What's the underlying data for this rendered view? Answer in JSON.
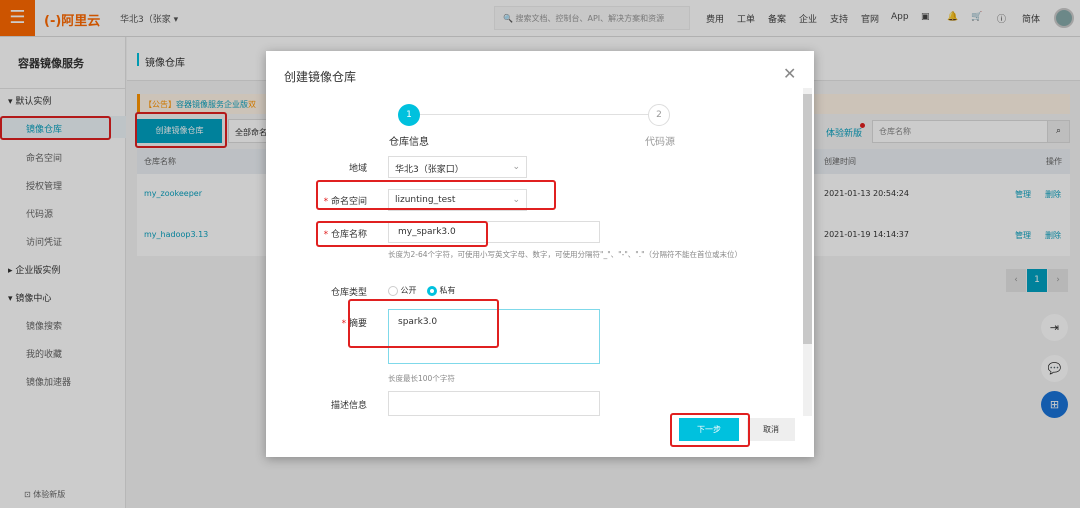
{
  "topbar": {
    "logo": "(-)阿里云",
    "region": "华北3（张家",
    "search_placeholder": "搜索文档、控制台、API、解决方案和资源",
    "nav": [
      "费用",
      "工单",
      "备案",
      "企业",
      "支持",
      "官网",
      "App"
    ],
    "lang": "简体"
  },
  "sidebar": {
    "title": "容器镜像服务",
    "group1": "默认实例",
    "items": [
      "镜像仓库",
      "命名空间",
      "授权管理",
      "代码源",
      "访问凭证"
    ],
    "group2": "企业版实例",
    "group3": "镜像中心",
    "items2": [
      "镜像搜索",
      "我的收藏",
      "镜像加速器"
    ],
    "footer": "体验新版"
  },
  "main": {
    "title": "镜像仓库",
    "notice_tag": "【公告】",
    "notice_text": "容器镜像服务企业版",
    "notice_more": "双",
    "create_button": "创建镜像仓库",
    "ns_filter": "全部命名",
    "try_new": "体验新版",
    "search_placeholder": "仓库名称",
    "columns": {
      "name": "仓库名称",
      "created": "创建时间",
      "actions": "操作"
    },
    "rows": [
      {
        "name": "my_zookeeper",
        "created": "2021-01-13 20:54:24"
      },
      {
        "name": "my_hadoop3.13",
        "created": "2021-01-19 14:14:37"
      }
    ],
    "manage": "管理",
    "delete": "删除",
    "page": "1"
  },
  "modal": {
    "title": "创建镜像仓库",
    "steps": [
      {
        "num": "1",
        "label": "仓库信息"
      },
      {
        "num": "2",
        "label": "代码源"
      }
    ],
    "region_label": "地域",
    "region_value": "华北3（张家口）",
    "ns_label": "命名空间",
    "ns_value": "lizunting_test",
    "name_label": "仓库名称",
    "name_value": "my_spark3.0",
    "name_hint": "长度为2-64个字符，可使用小写英文字母、数字，可使用分隔符\"_\"、\"-\"、\".\"（分隔符不能在首位或末位）",
    "type_label": "仓库类型",
    "type_public": "公开",
    "type_private": "私有",
    "summary_label": "摘要",
    "summary_value": "spark3.0",
    "summary_hint": "长度最长100个字符",
    "desc_label": "描述信息",
    "next": "下一步",
    "cancel": "取消",
    "required_mark": "*"
  }
}
